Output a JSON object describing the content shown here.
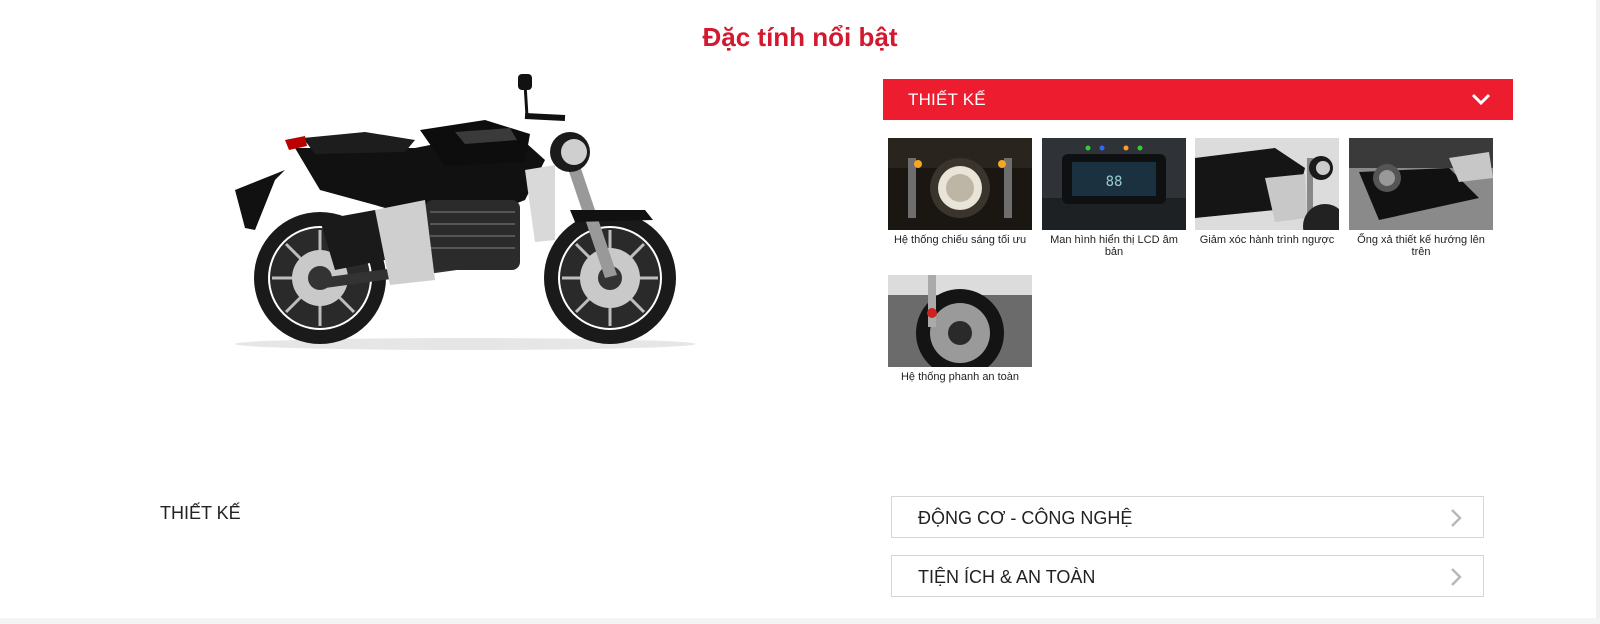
{
  "section": {
    "title": "Đặc tính nổi bật"
  },
  "hero": {
    "image_icon": "motorcycle-image"
  },
  "accordion_open": {
    "label": "THIẾT KẾ",
    "icon": "chevron-down-icon"
  },
  "features": [
    {
      "caption": "Hệ thống chiếu sáng tối ưu"
    },
    {
      "caption": "Man hình hiển thị LCD âm bản"
    },
    {
      "caption": "Giảm xóc hành trình ngược"
    },
    {
      "caption": "Ống xả thiết kế hướng lên trên"
    },
    {
      "caption": "Hệ thống phanh an toàn"
    }
  ],
  "left_label": "THIẾT KẾ",
  "accordions_closed": [
    {
      "label": "ĐỘNG CƠ - CÔNG NGHỆ",
      "icon": "chevron-right-icon"
    },
    {
      "label": "TIỆN ÍCH & AN TOÀN",
      "icon": "chevron-right-icon"
    }
  ],
  "colors": {
    "brand_red": "#ed1c2e",
    "title_red": "#d3192f"
  }
}
